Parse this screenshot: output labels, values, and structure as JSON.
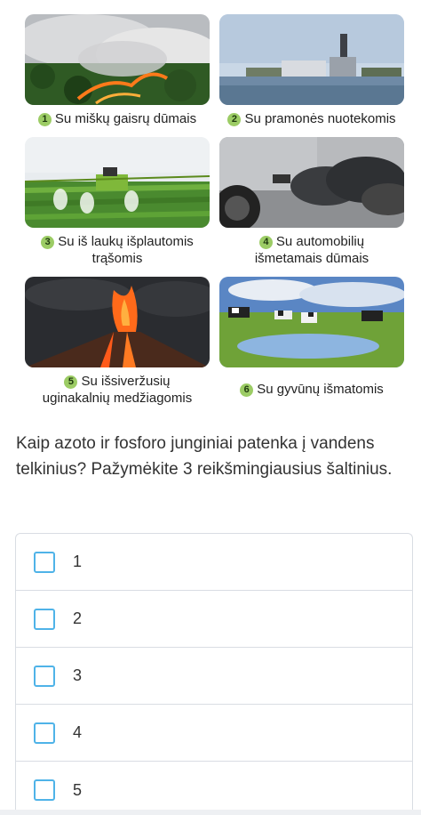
{
  "images": [
    {
      "num": "1",
      "caption_l1": "Su miškų gaisrų dūmais",
      "caption_l2": "",
      "icon": "forest-fire-photo"
    },
    {
      "num": "2",
      "caption_l1": "Su pramonės nuotekomis",
      "caption_l2": "",
      "icon": "factory-photo"
    },
    {
      "num": "3",
      "caption_l1": "Su iš laukų išplautomis",
      "caption_l2": "trąšomis",
      "icon": "field-spraying-photo"
    },
    {
      "num": "4",
      "caption_l1": "Su automobilių",
      "caption_l2": "išmetamais dūmais",
      "icon": "car-exhaust-photo"
    },
    {
      "num": "5",
      "caption_l1": "Su išsiveržusių",
      "caption_l2": "uginakalnių medžiagomis",
      "icon": "volcano-photo"
    },
    {
      "num": "6",
      "caption_l1": "Su gyvūnų išmatomis",
      "caption_l2": "",
      "icon": "cows-photo"
    }
  ],
  "question": "Kaip azoto ir fosforo junginiai patenka į vandens telkinius? Pažymėkite 3 reikšmingiausius šaltinius.",
  "options": [
    "1",
    "2",
    "3",
    "4",
    "5"
  ],
  "colors": {
    "badge": "#9ccc65",
    "checkbox_border": "#4fb3e8",
    "divider": "#d9dde3"
  }
}
